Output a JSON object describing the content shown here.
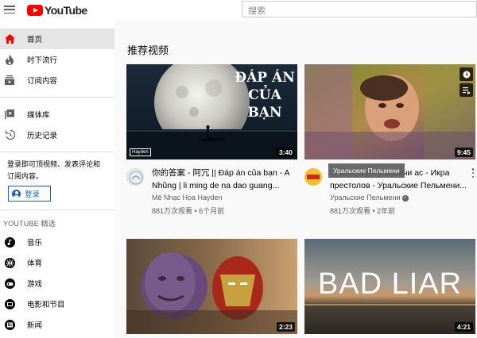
{
  "header": {
    "logo_text": "YouTube",
    "search_placeholder": "搜索"
  },
  "sidebar": {
    "items": [
      {
        "label": "首页",
        "icon": "home-icon",
        "active": true
      },
      {
        "label": "时下流行",
        "icon": "trending-icon"
      },
      {
        "label": "订阅内容",
        "icon": "subscriptions-icon"
      },
      {
        "label": "媒体库",
        "icon": "library-icon"
      },
      {
        "label": "历史记录",
        "icon": "history-icon"
      }
    ],
    "signin_prompt": "登录即可顶视频、发表评论和订阅内容。",
    "signin_button": "登录",
    "section_title": "YOUTUBE 精选",
    "featured": [
      {
        "label": "音乐",
        "icon": "music-icon"
      },
      {
        "label": "体育",
        "icon": "sports-icon"
      },
      {
        "label": "游戏",
        "icon": "gaming-icon"
      },
      {
        "label": "电影和节目",
        "icon": "movies-icon"
      },
      {
        "label": "新闻",
        "icon": "news-icon"
      }
    ]
  },
  "main": {
    "title": "推荐视频",
    "videos": [
      {
        "thumb_title": "ĐÁP ÁN CỦA BẠN",
        "thumb_caption": "Hayden",
        "duration": "3:40",
        "title": "你的答案 - 阿冗 || Đáp án của bạn - A Nhũng | li ming de na dao guang...",
        "channel": "Mê Nhạc Hoa Hayden",
        "stats": "881万次观看 • 6个月前"
      },
      {
        "duration": "9:45",
        "tooltip": "Уральские Пельмени",
        "title": "Уральские Пельмени - Угадайте кто идет в гости? Бегом, вставляйте стекла 6 ас - Икра престолов - Уральские Пельмени",
        "title_visible": "Уральские Пельмени ас - Икра престолов - Уральские Пельмени...",
        "channel": "Уральские Пельмени",
        "stats": "881万次观看 • 2年前"
      },
      {
        "duration": "2:23"
      },
      {
        "thumb_title": "BAD LIAR",
        "duration": "4:21"
      }
    ]
  },
  "colors": {
    "brand_red": "#ff0000",
    "link_blue": "#1565c0",
    "secondary_text": "#606060"
  }
}
